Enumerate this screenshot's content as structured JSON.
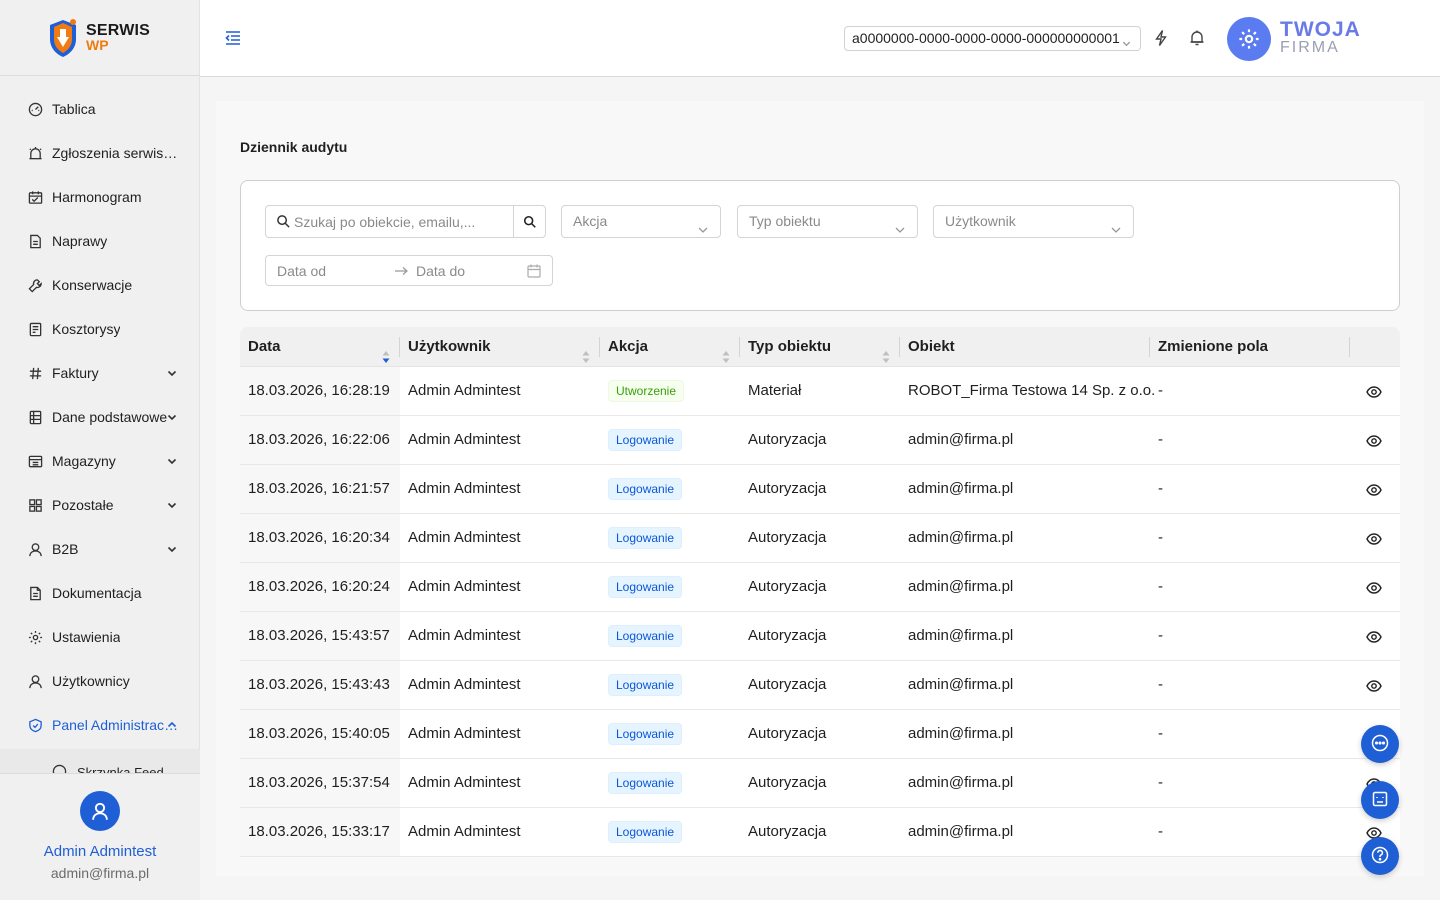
{
  "app": {
    "logo_line1": "SERWIS",
    "logo_line2": "WP",
    "company_line1": "TWOJA",
    "company_line2": "FIRMA"
  },
  "header": {
    "tenant_value": "a0000000-0000-0000-0000-000000000001"
  },
  "sidebar": {
    "items": [
      {
        "label": "Tablica",
        "icon": "dashboard-icon"
      },
      {
        "label": "Zgłoszenia serwisowe",
        "icon": "alarm-icon"
      },
      {
        "label": "Harmonogram",
        "icon": "calendar-icon"
      },
      {
        "label": "Naprawy",
        "icon": "document-icon"
      },
      {
        "label": "Konserwacje",
        "icon": "wrench-icon"
      },
      {
        "label": "Kosztorysy",
        "icon": "estimate-icon"
      },
      {
        "label": "Faktury",
        "icon": "hash-icon"
      },
      {
        "label": "Dane podstawowe",
        "icon": "database-icon"
      },
      {
        "label": "Magazyny",
        "icon": "warehouse-icon"
      },
      {
        "label": "Pozostałe",
        "icon": "grid-icon"
      },
      {
        "label": "B2B",
        "icon": "user-icon"
      },
      {
        "label": "Dokumentacja",
        "icon": "docs-icon"
      },
      {
        "label": "Ustawienia",
        "icon": "gear-icon"
      },
      {
        "label": "Użytkownicy",
        "icon": "users-icon"
      },
      {
        "label": "Panel Administracyjny",
        "icon": "shield-icon"
      }
    ],
    "sub_item": "Skrzynka Feed",
    "user_name": "Admin Admintest",
    "user_email": "admin@firma.pl"
  },
  "page": {
    "title": "Dziennik audytu"
  },
  "filters": {
    "search_placeholder": "Szukaj po obiekcie, emailu,...",
    "action_placeholder": "Akcja",
    "object_type_placeholder": "Typ obiektu",
    "user_placeholder": "Użytkownik",
    "date_from_placeholder": "Data od",
    "date_to_placeholder": "Data do"
  },
  "table": {
    "columns": [
      "Data",
      "Użytkownik",
      "Akcja",
      "Typ obiektu",
      "Obiekt",
      "Zmienione pola"
    ],
    "rows": [
      {
        "date": "18.03.2026, 16:28:19",
        "user": "Admin Admintest",
        "action": "Utworzenie",
        "action_color": "green",
        "type": "Materiał",
        "object": "ROBOT_Firma Testowa 14 Sp. z o.o.",
        "changed": "-"
      },
      {
        "date": "18.03.2026, 16:22:06",
        "user": "Admin Admintest",
        "action": "Logowanie",
        "action_color": "blue",
        "type": "Autoryzacja",
        "object": "admin@firma.pl",
        "changed": "-"
      },
      {
        "date": "18.03.2026, 16:21:57",
        "user": "Admin Admintest",
        "action": "Logowanie",
        "action_color": "blue",
        "type": "Autoryzacja",
        "object": "admin@firma.pl",
        "changed": "-"
      },
      {
        "date": "18.03.2026, 16:20:34",
        "user": "Admin Admintest",
        "action": "Logowanie",
        "action_color": "blue",
        "type": "Autoryzacja",
        "object": "admin@firma.pl",
        "changed": "-"
      },
      {
        "date": "18.03.2026, 16:20:24",
        "user": "Admin Admintest",
        "action": "Logowanie",
        "action_color": "blue",
        "type": "Autoryzacja",
        "object": "admin@firma.pl",
        "changed": "-"
      },
      {
        "date": "18.03.2026, 15:43:57",
        "user": "Admin Admintest",
        "action": "Logowanie",
        "action_color": "blue",
        "type": "Autoryzacja",
        "object": "admin@firma.pl",
        "changed": "-"
      },
      {
        "date": "18.03.2026, 15:43:43",
        "user": "Admin Admintest",
        "action": "Logowanie",
        "action_color": "blue",
        "type": "Autoryzacja",
        "object": "admin@firma.pl",
        "changed": "-"
      },
      {
        "date": "18.03.2026, 15:40:05",
        "user": "Admin Admintest",
        "action": "Logowanie",
        "action_color": "blue",
        "type": "Autoryzacja",
        "object": "admin@firma.pl",
        "changed": "-"
      },
      {
        "date": "18.03.2026, 15:37:54",
        "user": "Admin Admintest",
        "action": "Logowanie",
        "action_color": "blue",
        "type": "Autoryzacja",
        "object": "admin@firma.pl",
        "changed": "-"
      },
      {
        "date": "18.03.2026, 15:33:17",
        "user": "Admin Admintest",
        "action": "Logowanie",
        "action_color": "blue",
        "type": "Autoryzacja",
        "object": "admin@firma.pl",
        "changed": "-"
      }
    ]
  },
  "colors": {
    "accent": "#1f5fd6",
    "logo_orange": "#f07b13",
    "company_purple": "#6a7be8"
  }
}
